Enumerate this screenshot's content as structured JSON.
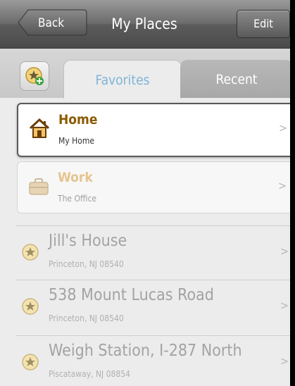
{
  "nav": {
    "back_label": "Back",
    "title": "My Places",
    "edit_label": "Edit"
  },
  "tabs": {
    "favorites_label": "Favorites",
    "recent_label": "Recent",
    "active": "Favorites"
  },
  "favorites": [
    {
      "title": "Home",
      "subtitle": "My Home",
      "icon": "house-icon",
      "selected": true
    },
    {
      "title": "Work",
      "subtitle": "The Office",
      "icon": "briefcase-icon",
      "selected": false
    }
  ],
  "recents": [
    {
      "title": "Jill's House",
      "subtitle": "Princeton, NJ 08540",
      "icon": "star-icon"
    },
    {
      "title": "538 Mount Lucas Road",
      "subtitle": "Princeton, NJ 08540",
      "icon": "star-icon"
    },
    {
      "title": "Weigh Station, I-287 North",
      "subtitle": "Piscataway, NJ 08854",
      "icon": "star-icon"
    }
  ],
  "chevron": ">",
  "colors": {
    "accent_tab": "#7fb3d8",
    "home_title": "#8c5a00",
    "work_title": "#e6c48e",
    "star": "#f4d27a"
  }
}
